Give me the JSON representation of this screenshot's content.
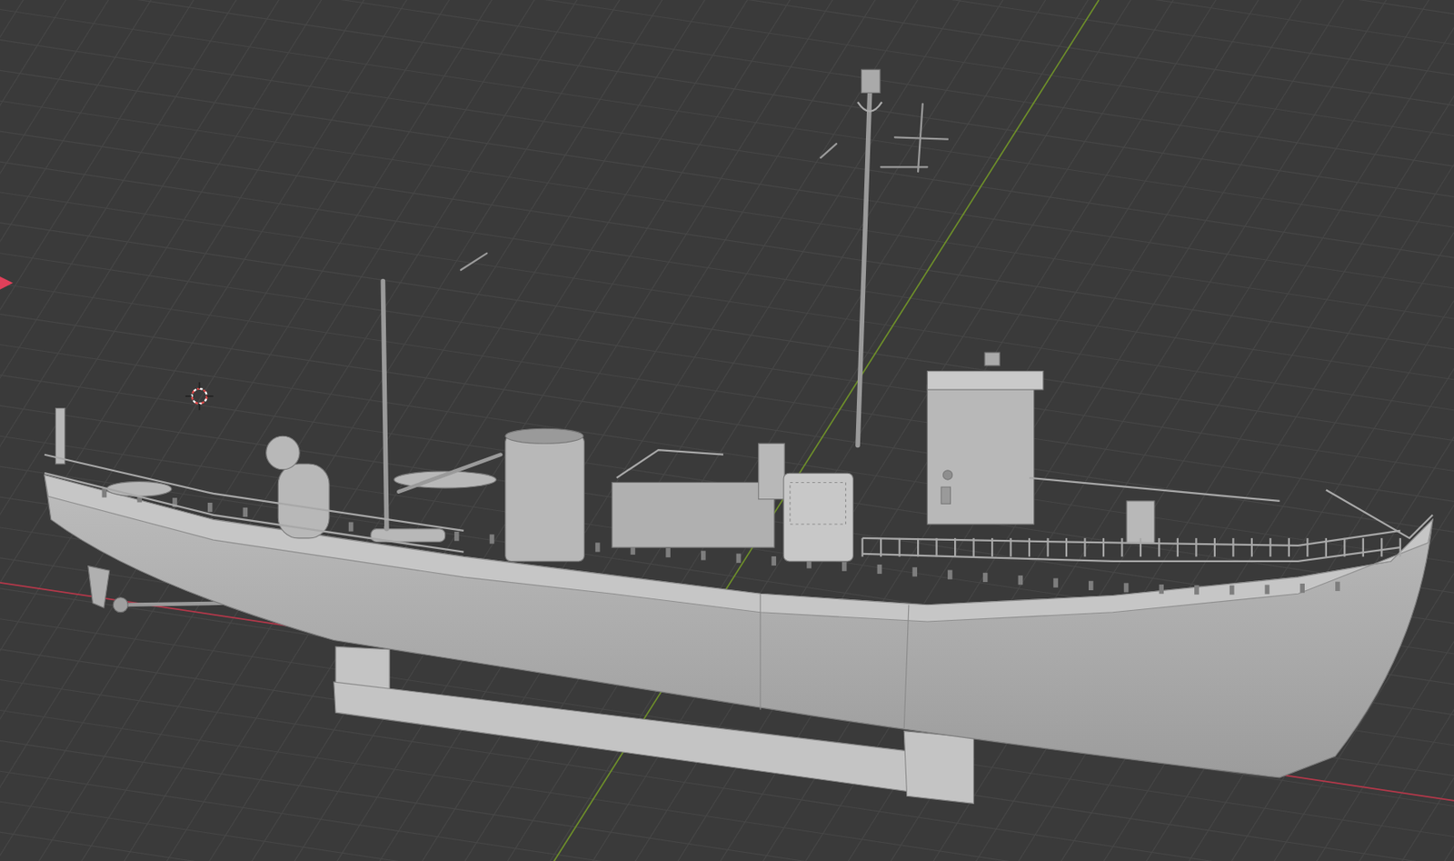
{
  "viewport": {
    "grid": true,
    "axes": {
      "x": true,
      "y": true
    },
    "cursor": true,
    "shading": "solid",
    "model": {
      "visible": true,
      "on_stand": true
    }
  }
}
